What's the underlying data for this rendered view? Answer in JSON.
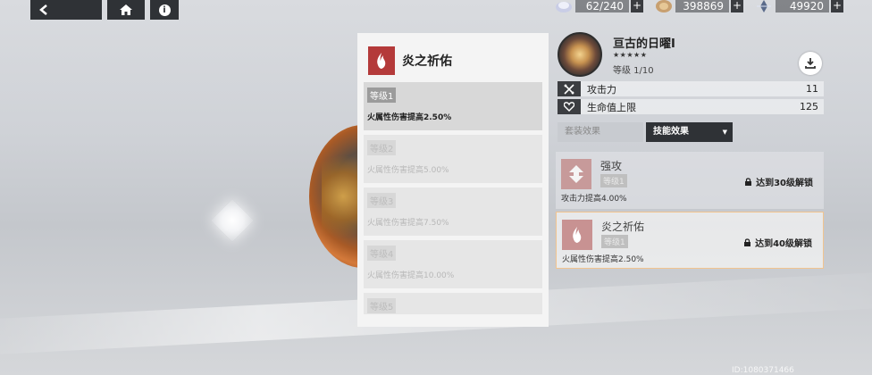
{
  "resources": [
    {
      "icon": "energy-icon",
      "value": "62/240"
    },
    {
      "icon": "coin-icon",
      "value": "398869"
    },
    {
      "icon": "crystal-icon",
      "value": "49920"
    }
  ],
  "plus_symbol": "+",
  "panel": {
    "title": "炎之祈佑",
    "levels": [
      {
        "badge": "等级1",
        "desc": "火属性伤害提高2.50%"
      },
      {
        "badge": "等级2",
        "desc": "火属性伤害提高5.00%"
      },
      {
        "badge": "等级3",
        "desc": "火属性伤害提高7.50%"
      },
      {
        "badge": "等级4",
        "desc": "火属性伤害提高10.00%"
      },
      {
        "badge": "等级5",
        "desc": ""
      }
    ]
  },
  "card": {
    "name": "亘古的日曜I",
    "stars": "★★★★★",
    "level": "等级 1/10"
  },
  "stats": [
    {
      "icon": "sword-icon",
      "label": "攻击力",
      "value": "11"
    },
    {
      "icon": "heart-icon",
      "label": "生命值上限",
      "value": "125"
    }
  ],
  "tabs": {
    "set_effect": "套装效果",
    "skill_effect": "技能效果",
    "caret": "▼"
  },
  "effects": [
    {
      "name": "强攻",
      "badge": "等级1",
      "desc": "攻击力提高4.00%",
      "lock": "达到30级解锁"
    },
    {
      "name": "炎之祈佑",
      "badge": "等级1",
      "desc": "火属性伤害提高2.50%",
      "lock": "达到40级解锁"
    }
  ],
  "footer_id": "ID:1080371466"
}
